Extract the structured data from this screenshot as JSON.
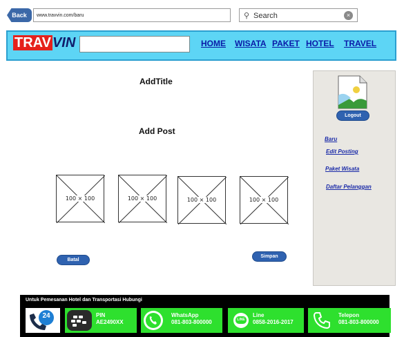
{
  "browser": {
    "back_label": "Back",
    "url": "www.travvin.com/baru",
    "search_placeholder": "Search"
  },
  "header": {
    "logo_part1": "TRAV",
    "logo_part2": "VIN",
    "nav": [
      {
        "label": "HOME"
      },
      {
        "label": "WISATA"
      },
      {
        "label": "PAKET"
      },
      {
        "label": "HOTEL"
      },
      {
        "label": "TRAVEL"
      }
    ]
  },
  "main": {
    "title": "AddTitle",
    "post": "Add Post",
    "image_placeholders": [
      {
        "label": "100 × 100"
      },
      {
        "label": "100 × 100"
      },
      {
        "label": "100 × 100"
      },
      {
        "label": "100 × 100"
      }
    ],
    "cancel_label": "Batal",
    "save_label": "Simpan"
  },
  "sidebar": {
    "logout_label": "Logout",
    "links": [
      {
        "label": "Baru"
      },
      {
        "label": "Edit Posting"
      },
      {
        "label": "Paket Wisata"
      },
      {
        "label": "Daftar Pelanggan"
      }
    ]
  },
  "footer": {
    "title": "Untuk Pemesanan Hotel dan Transportasi Hubungi",
    "contacts": [
      {
        "name": "PIN",
        "value": "AE2490XX",
        "icon": "bbm-icon",
        "color": "#2ee02e"
      },
      {
        "name": "WhatsApp",
        "value": "081-803-800000",
        "icon": "whatsapp-icon",
        "color": "#2ee02e"
      },
      {
        "name": "Line",
        "value": "0858-2016-2017",
        "icon": "line-icon",
        "color": "#2ee02e"
      },
      {
        "name": "Telepon",
        "value": "081-803-800000",
        "icon": "phone-icon",
        "color": "#2ee02e"
      }
    ],
    "badge_24": "24"
  },
  "colors": {
    "nav_bg": "#5dd5f5",
    "accent_blue": "#2f62b0",
    "logo_red": "#e5211c",
    "footer_green": "#2ee02e"
  }
}
